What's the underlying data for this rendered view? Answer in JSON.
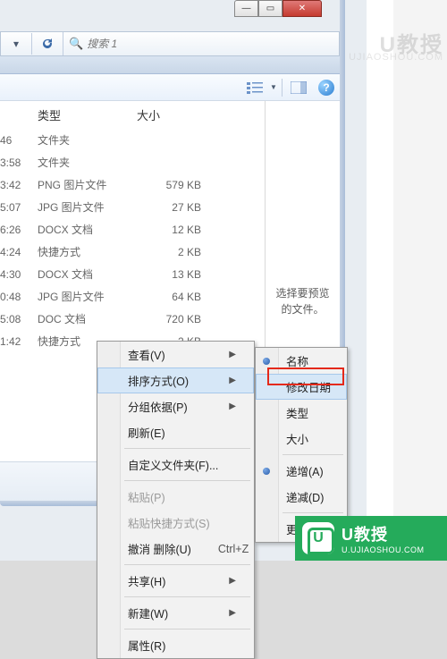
{
  "search": {
    "placeholder": "搜索 1"
  },
  "headers": {
    "type": "类型",
    "size": "大小"
  },
  "files": [
    {
      "time": "46",
      "type": "文件夹",
      "size": ""
    },
    {
      "time": "3:58",
      "type": "文件夹",
      "size": ""
    },
    {
      "time": "3:42",
      "type": "PNG 图片文件",
      "size": "579 KB"
    },
    {
      "time": "5:07",
      "type": "JPG 图片文件",
      "size": "27 KB"
    },
    {
      "time": "6:26",
      "type": "DOCX 文档",
      "size": "12 KB"
    },
    {
      "time": "4:24",
      "type": "快捷方式",
      "size": "2 KB"
    },
    {
      "time": "4:30",
      "type": "DOCX 文档",
      "size": "13 KB"
    },
    {
      "time": "0:48",
      "type": "JPG 图片文件",
      "size": "64 KB"
    },
    {
      "time": "5:08",
      "type": "DOC 文档",
      "size": "720 KB"
    },
    {
      "time": "1:42",
      "type": "快捷方式",
      "size": "2 KB"
    }
  ],
  "preview": {
    "message_line1": "选择要预览",
    "message_line2": "的文件。"
  },
  "context_menu": {
    "view": "查看(V)",
    "sort_by": "排序方式(O)",
    "group_by": "分组依据(P)",
    "refresh": "刷新(E)",
    "customize": "自定义文件夹(F)...",
    "paste": "粘贴(P)",
    "paste_shortcut": "粘贴快捷方式(S)",
    "undo_delete": "撤消 删除(U)",
    "undo_shortcut": "Ctrl+Z",
    "share": "共享(H)",
    "new": "新建(W)",
    "properties": "属性(R)"
  },
  "sort_submenu": {
    "name": "名称",
    "date_modified": "修改日期",
    "type": "类型",
    "size": "大小",
    "ascending": "递增(A)",
    "descending": "递减(D)",
    "more": "更多(M)..."
  },
  "brand": {
    "title": "U教授",
    "subtitle": "U.UJIAOSHOU.COM"
  },
  "watermark": {
    "big": "U教授",
    "small": "UJIAOSHOU.COM"
  }
}
